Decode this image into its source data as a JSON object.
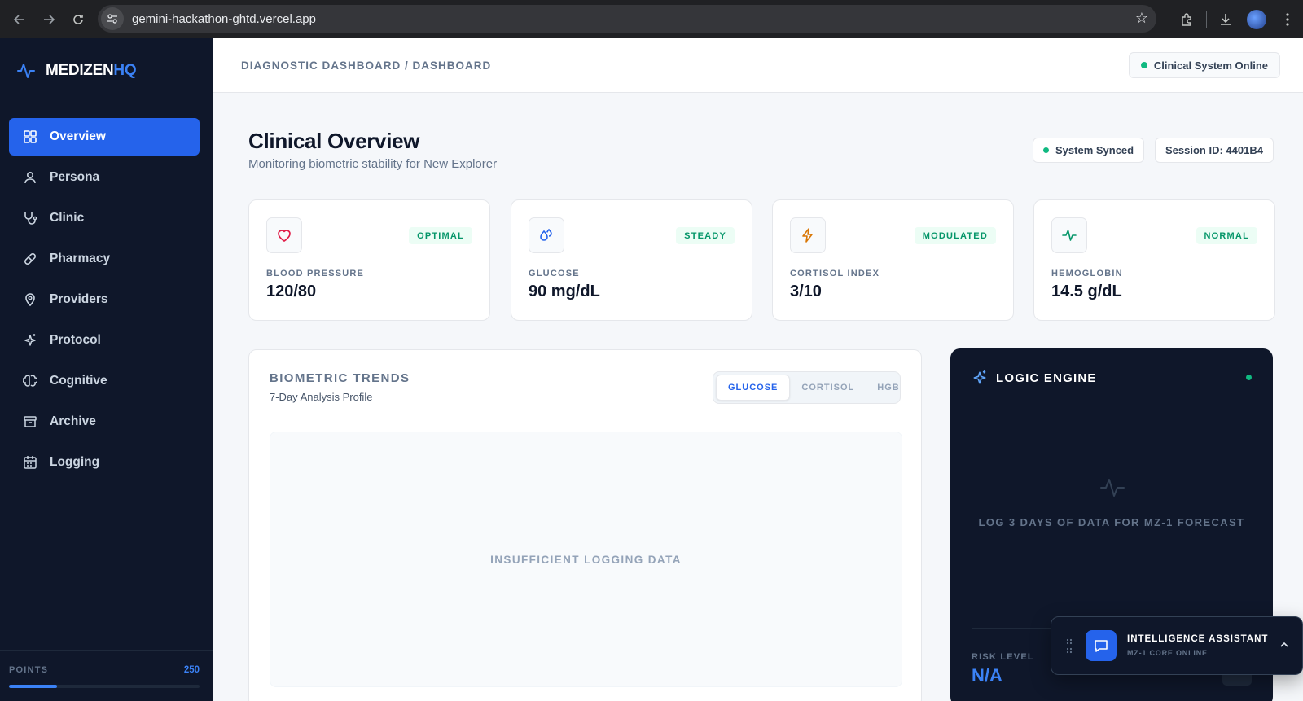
{
  "browser": {
    "url": "gemini-hackathon-ghtd.vercel.app"
  },
  "brand": {
    "name_main": "MEDIZEN",
    "name_accent": "HQ",
    "accent_color": "#3b82f6"
  },
  "sidebar": {
    "items": [
      {
        "label": "Overview",
        "icon": "grid-icon",
        "active": true
      },
      {
        "label": "Persona",
        "icon": "user-icon"
      },
      {
        "label": "Clinic",
        "icon": "stethoscope-icon"
      },
      {
        "label": "Pharmacy",
        "icon": "pill-icon"
      },
      {
        "label": "Providers",
        "icon": "map-pin-icon"
      },
      {
        "label": "Protocol",
        "icon": "sparkles-icon"
      },
      {
        "label": "Cognitive",
        "icon": "brain-icon"
      },
      {
        "label": "Archive",
        "icon": "archive-icon"
      },
      {
        "label": "Logging",
        "icon": "calendar-icon"
      }
    ],
    "points": {
      "label": "POINTS",
      "value": "250",
      "progress": 0.25
    }
  },
  "header": {
    "breadcrumb": "DIAGNOSTIC DASHBOARD / DASHBOARD",
    "status": "Clinical System Online"
  },
  "overview": {
    "title": "Clinical Overview",
    "subtitle": "Monitoring biometric stability for New Explorer",
    "sync_status": "System Synced",
    "session": "Session ID: 4401B4"
  },
  "stats": [
    {
      "label": "BLOOD PRESSURE",
      "value": "120/80",
      "badge": "OPTIMAL",
      "icon": "heart-icon",
      "color": "#e11d48"
    },
    {
      "label": "GLUCOSE",
      "value": "90 mg/dL",
      "badge": "STEADY",
      "icon": "droplets-icon",
      "color": "#2563eb"
    },
    {
      "label": "CORTISOL INDEX",
      "value": "3/10",
      "badge": "MODULATED",
      "icon": "zap-icon",
      "color": "#d97706"
    },
    {
      "label": "HEMOGLOBIN",
      "value": "14.5 g/dL",
      "badge": "NORMAL",
      "icon": "activity-icon",
      "color": "#059669"
    }
  ],
  "trends": {
    "title": "BIOMETRIC TRENDS",
    "subtitle": "7-Day Analysis Profile",
    "tabs": [
      {
        "label": "GLUCOSE",
        "active": true
      },
      {
        "label": "CORTISOL"
      },
      {
        "label": "HGB"
      }
    ],
    "empty_message": "INSUFFICIENT LOGGING DATA"
  },
  "logic_engine": {
    "title": "LOGIC ENGINE",
    "message": "LOG 3 DAYS OF DATA FOR MZ-1 FORECAST",
    "risk_label": "RISK LEVEL",
    "risk_value": "N/A"
  },
  "assistant": {
    "title": "INTELLIGENCE ASSISTANT",
    "subtitle": "MZ-1 CORE ONLINE"
  }
}
